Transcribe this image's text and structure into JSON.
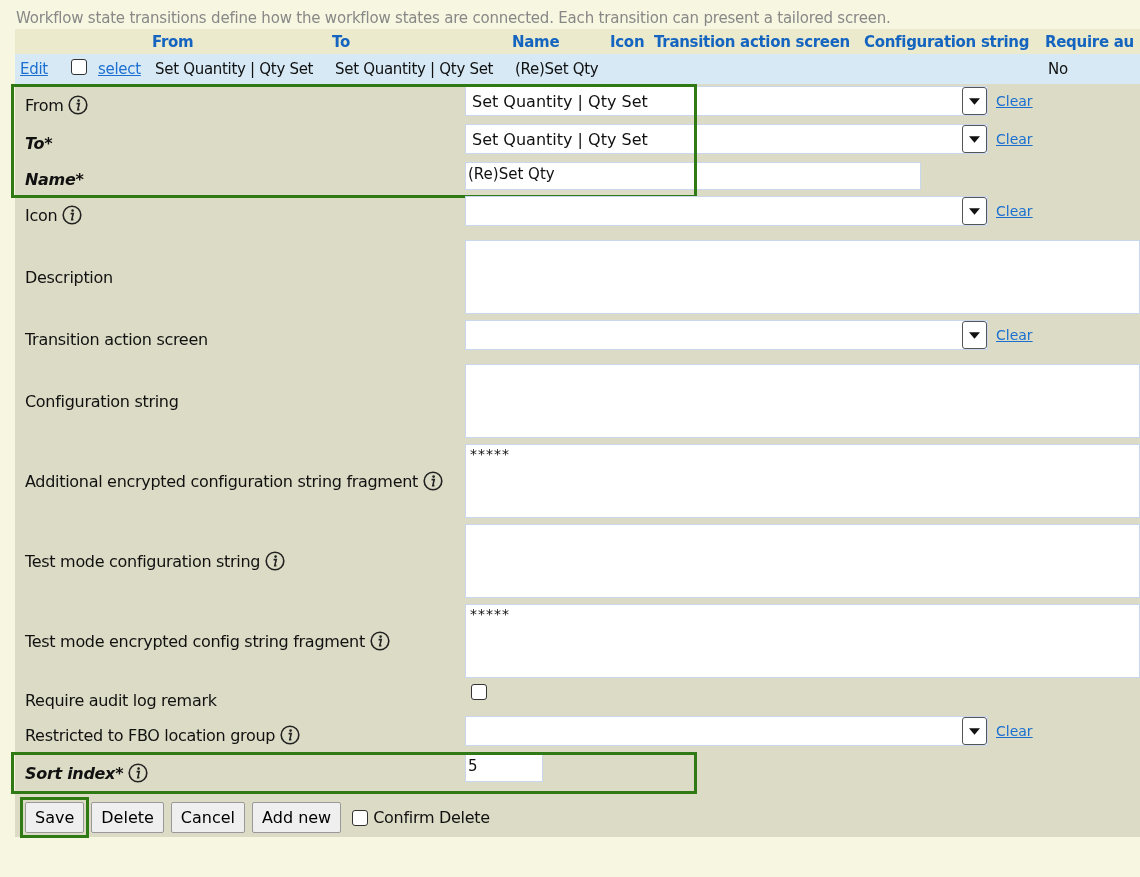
{
  "intro": "Workflow state transitions define how the workflow states are connected. Each transition can present a tailored screen.",
  "table": {
    "columns": [
      "From",
      "To",
      "Name",
      "Icon",
      "Transition action screen",
      "Configuration string",
      "Require au"
    ],
    "rows": [
      {
        "edit": "Edit",
        "checked": false,
        "select": "select",
        "cells": [
          "Set Quantity | Qty Set",
          "Set Quantity | Qty Set",
          "(Re)Set Qty",
          "",
          "",
          "",
          "No"
        ]
      }
    ]
  },
  "form": {
    "fields": [
      {
        "kind": "select",
        "label": "From",
        "required": false,
        "info": true,
        "value": "Set Quantity | Qty Set",
        "clear": "Clear",
        "highlighted": true
      },
      {
        "kind": "select",
        "label": "To*",
        "required": true,
        "info": false,
        "value": "Set Quantity | Qty Set",
        "clear": "Clear",
        "highlighted": true
      },
      {
        "kind": "text",
        "label": "Name*",
        "required": true,
        "info": false,
        "value": "(Re)Set Qty",
        "highlighted": true
      },
      {
        "kind": "select",
        "label": "Icon",
        "required": false,
        "info": true,
        "clear": "Clear",
        "highlighted": false
      },
      {
        "kind": "textarea",
        "label": "Description",
        "required": false,
        "info": false,
        "highlighted": false
      },
      {
        "kind": "select",
        "label": "Transition action screen",
        "required": false,
        "info": false,
        "clear": "Clear",
        "highlighted": false
      },
      {
        "kind": "textarea",
        "label": "Configuration string",
        "required": false,
        "info": false,
        "highlighted": false
      },
      {
        "kind": "textarea",
        "label": "Additional encrypted configuration string fragment",
        "required": false,
        "info": true,
        "value": "*****",
        "highlighted": false
      },
      {
        "kind": "textarea",
        "label": "Test mode configuration string",
        "required": false,
        "info": true,
        "highlighted": false
      },
      {
        "kind": "textarea",
        "label": "Test mode encrypted config string fragment",
        "required": false,
        "info": true,
        "value": "*****",
        "highlighted": false
      },
      {
        "kind": "checkbox",
        "label": "Require audit log remark",
        "required": false,
        "info": false,
        "checked": false,
        "highlighted": false
      },
      {
        "kind": "select",
        "label": "Restricted to FBO location group",
        "required": false,
        "info": true,
        "clear": "Clear",
        "highlighted": false
      },
      {
        "kind": "short",
        "label": "Sort index*",
        "required": true,
        "info": true,
        "value": "5",
        "highlighted": true
      }
    ],
    "buttons": [
      {
        "label": "Save",
        "highlighted": true
      },
      {
        "label": "Delete",
        "highlighted": false
      },
      {
        "label": "Cancel",
        "highlighted": false
      },
      {
        "label": "Add new",
        "highlighted": false
      }
    ],
    "confirm": {
      "label": "Confirm Delete",
      "checked": false
    }
  }
}
